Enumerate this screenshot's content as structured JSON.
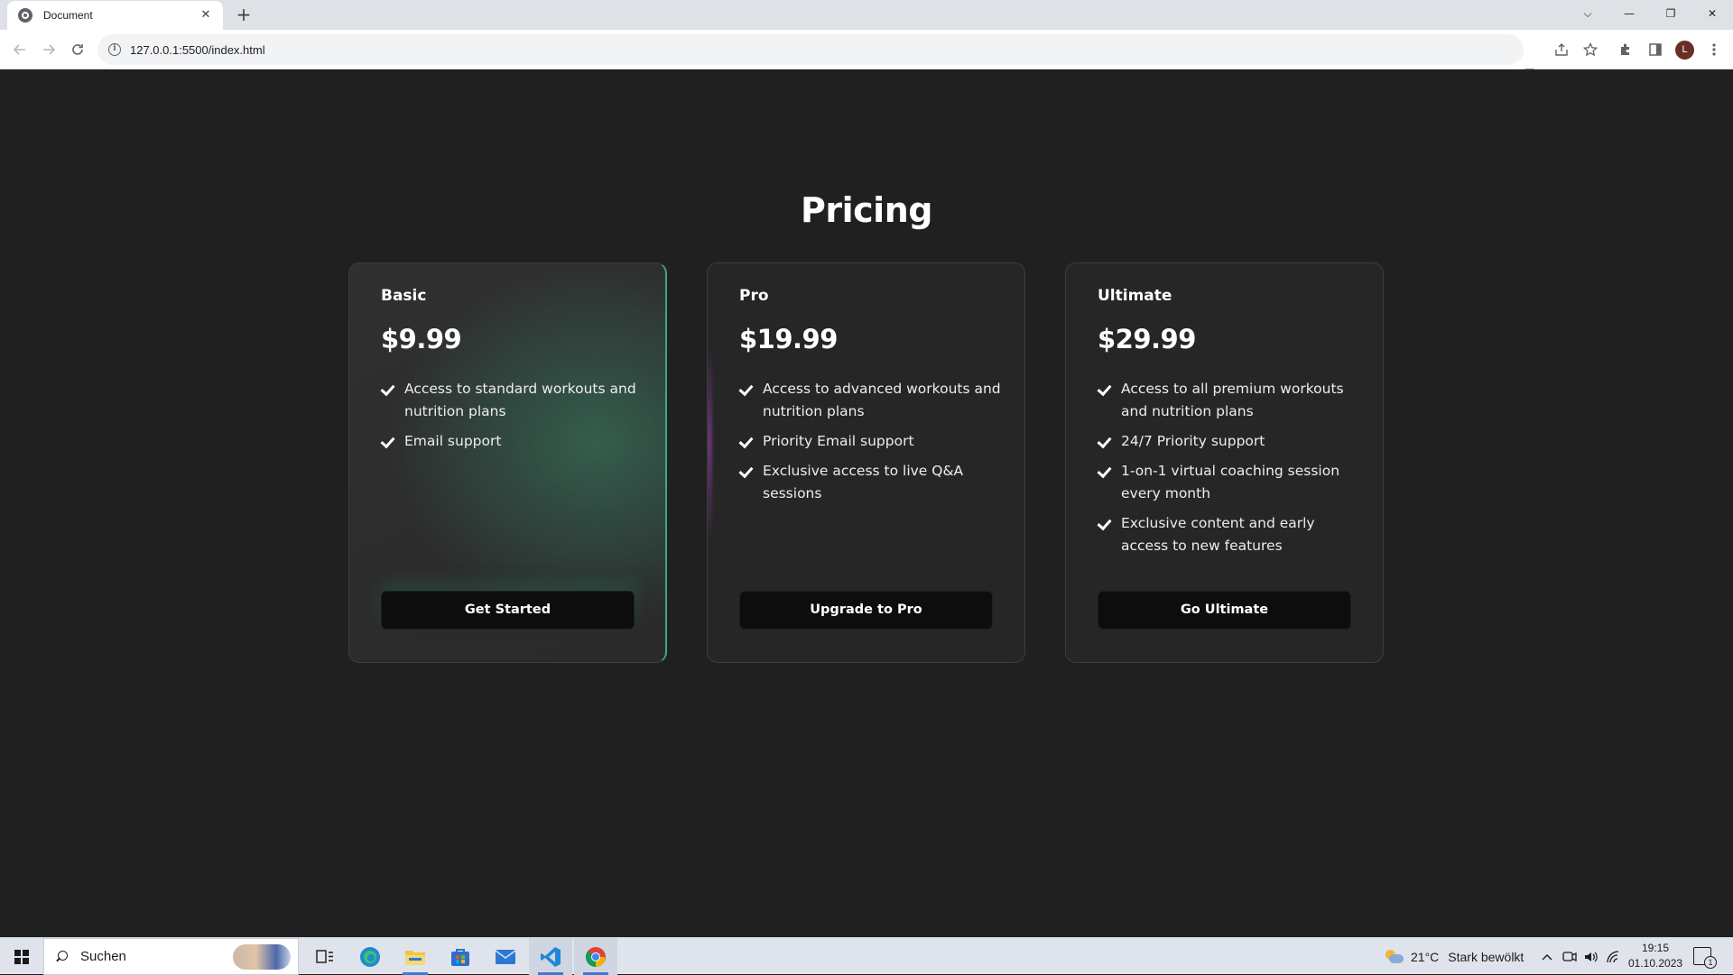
{
  "browser": {
    "tab": {
      "title": "Document",
      "close_glyph": "✕"
    },
    "new_tab_glyph": "+",
    "window_controls": {
      "menu": "⌵",
      "minimize": "—",
      "restore": "❐",
      "close": "✕"
    },
    "url": "127.0.0.1:5500/index.html",
    "icons": [
      "back-icon",
      "forward-icon",
      "reload-icon",
      "site-info-icon",
      "translate-icon",
      "share-icon",
      "bookmark-star-icon",
      "extensions-icon",
      "side-panel-icon",
      "profile-avatar",
      "more-menu-icon"
    ],
    "profile_initial": "L"
  },
  "page": {
    "title": "Pricing",
    "plans": [
      {
        "name": "Basic",
        "price": "$9.99",
        "features": [
          "Access to standard workouts and nutrition plans",
          "Email support"
        ],
        "cta": "Get Started",
        "accent": "#3aa88a"
      },
      {
        "name": "Pro",
        "price": "$19.99",
        "features": [
          "Access to advanced workouts and nutrition plans",
          "Priority Email support",
          "Exclusive access to live Q&A sessions"
        ],
        "cta": "Upgrade to Pro",
        "accent": "#a846c8"
      },
      {
        "name": "Ultimate",
        "price": "$29.99",
        "features": [
          "Access to all premium workouts and nutrition plans",
          "24/7 Priority support",
          "1-on-1 virtual coaching session every month",
          "Exclusive content and early access to new features"
        ],
        "cta": "Go Ultimate"
      }
    ]
  },
  "taskbar": {
    "search_placeholder": "Suchen",
    "apps": [
      "task-view-icon",
      "edge-icon",
      "file-explorer-icon",
      "store-icon",
      "mail-icon",
      "vscode-icon",
      "chrome-icon"
    ],
    "weather": {
      "temp": "21°C",
      "condition": "Stark bewölkt"
    },
    "time": "19:15",
    "date": "01.10.2023",
    "notification_count": "1"
  },
  "colors": {
    "page_bg": "#202020",
    "card_bg": "#262626",
    "button_bg": "#0d0d0d",
    "text": "#ffffff"
  }
}
